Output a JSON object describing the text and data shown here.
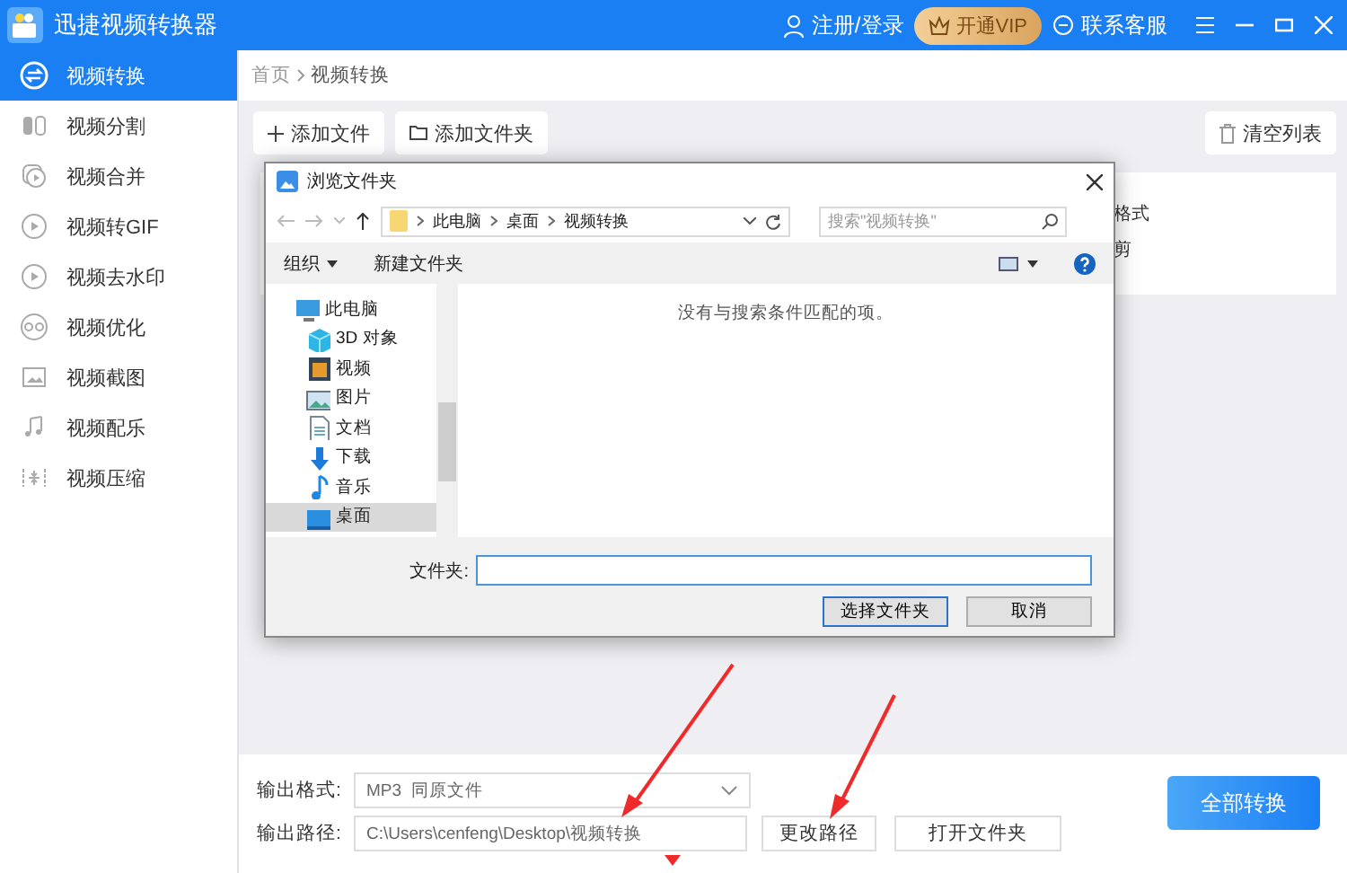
{
  "app": {
    "title": "迅捷视频转换器",
    "login": "注册/登录",
    "vip": "开通VIP",
    "support": "联系客服"
  },
  "sidebar": {
    "items": [
      {
        "label": "视频转换",
        "selected": true
      },
      {
        "label": "视频分割",
        "selected": false
      },
      {
        "label": "视频合并",
        "selected": false
      },
      {
        "label": "视频转GIF",
        "selected": false
      },
      {
        "label": "视频去水印",
        "selected": false
      },
      {
        "label": "视频优化",
        "selected": false
      },
      {
        "label": "视频截图",
        "selected": false
      },
      {
        "label": "视频配乐",
        "selected": false
      },
      {
        "label": "视频压缩",
        "selected": false
      }
    ]
  },
  "breadcrumb": [
    "首页",
    "视频转换"
  ],
  "toolbar": {
    "add_file": "添加文件",
    "add_folder": "添加文件夹",
    "clear": "清空列表"
  },
  "card_partial": [
    "格式",
    "剪"
  ],
  "dialog": {
    "title": "浏览文件夹",
    "path": [
      "此电脑",
      "桌面",
      "视频转换"
    ],
    "search_placeholder": "搜索\"视频转换\"",
    "organize": "组织",
    "new_folder": "新建文件夹",
    "tree": [
      {
        "label": "此电脑",
        "kind": "pc",
        "selected": false,
        "children": [
          {
            "label": "3D 对象",
            "kind": "cube",
            "selected": false
          },
          {
            "label": "视频",
            "kind": "video",
            "selected": false
          },
          {
            "label": "图片",
            "kind": "picture",
            "selected": false
          },
          {
            "label": "文档",
            "kind": "document",
            "selected": false
          },
          {
            "label": "下载",
            "kind": "download",
            "selected": false
          },
          {
            "label": "音乐",
            "kind": "music",
            "selected": false
          },
          {
            "label": "桌面",
            "kind": "desktop",
            "selected": true
          }
        ]
      }
    ],
    "empty_message": "没有与搜索条件匹配的项。",
    "folder_label": "文件夹:",
    "buttons": [
      "选择文件夹",
      "取消"
    ]
  },
  "output": {
    "format_label": "输出格式:",
    "format_value": "MP3  同原文件",
    "path_label": "输出路径:",
    "path_value": "C:\\Users\\cenfeng\\Desktop\\视频转换",
    "change_path": "更改路径",
    "open_folder": "打开文件夹",
    "convert_all": "全部转换"
  }
}
